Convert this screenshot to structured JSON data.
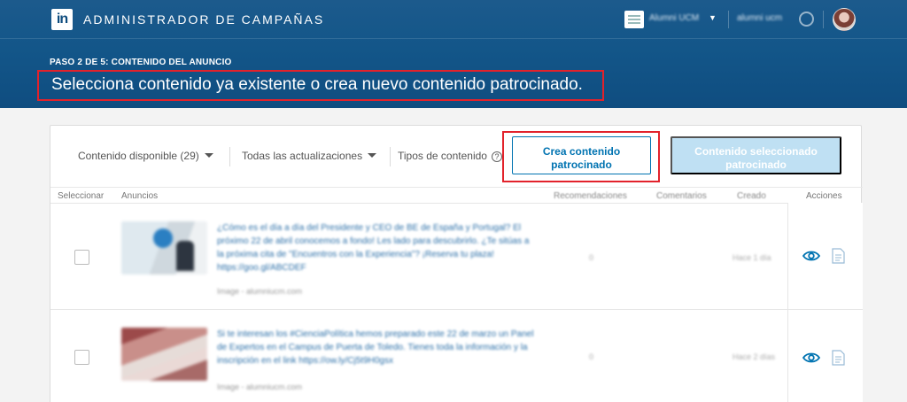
{
  "header": {
    "app_title": "ADMINISTRADOR DE CAMPAÑAS",
    "logo_text": "in",
    "account_name": "Alumni UCM",
    "user_name": "alumni ucm"
  },
  "page": {
    "step_label": "PASO 2 DE 5: CONTENIDO DEL ANUNCIO",
    "title": "Selecciona contenido ya existente o crea nuevo contenido patrocinado."
  },
  "toolbar": {
    "available_filter": "Contenido disponible (29)",
    "updates_filter": "Todas las actualizaciones",
    "content_types": "Tipos de contenido",
    "help_glyph": "?",
    "create_button": "Crea contenido patrocinado",
    "selected_button": "Contenido seleccionado patrocinado"
  },
  "table": {
    "columns": {
      "select": "Seleccionar",
      "ads": "Anuncios",
      "recommendations": "Recomendaciones",
      "comments": "Comentarios",
      "created": "Creado",
      "actions": "Acciones"
    },
    "rows": [
      {
        "text": "¿Cómo es el día a día del Presidente y CEO de BE de España y Portugal? El próximo 22 de abril conocemos a fondo! Les lado para descubrirlo. ¿Te sitúas a la próxima cita de \"Encuentros con la Experiencia\"? ¡Reserva tu plaza! https://goo.gl/ABCDEF",
        "meta": "Image - alumniucm.com",
        "recommendations": "0",
        "created": "Hace 1 día"
      },
      {
        "text": "Si te interesan los #CienciaPolítica hemos preparado este 22 de marzo un Panel de Expertos en el Campus de Puerta de Toledo. Tienes toda la información y la inscripción en el link https://ow.ly/Cj5t9H0gsx",
        "meta": "Image - alumniucm.com",
        "recommendations": "0",
        "created": "Hace 2 días"
      }
    ]
  },
  "icons": {
    "view": "eye-icon",
    "document": "document-icon",
    "help": "question-circle-icon"
  },
  "colors": {
    "header_bg": "#135689",
    "accent_blue": "#0073b1",
    "disabled_blue": "#bfe0f3",
    "highlight_red": "#e2222b"
  }
}
